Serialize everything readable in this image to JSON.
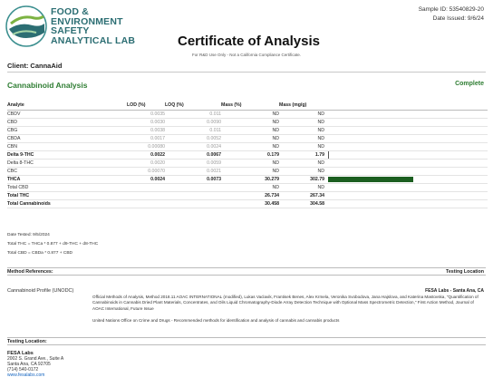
{
  "logo": {
    "lines": [
      "FOOD &",
      "ENVIRONMENT",
      "SAFETY",
      "ANALYTICAL LAB"
    ]
  },
  "header": {
    "sample_id": "Sample ID: 53540829-20",
    "date_issued": "Date Issued: 9/6/24",
    "title": "Certificate of Analysis",
    "rd_note": "For R&D Use Only - Not a California Compliance Certificate."
  },
  "client": "Client: CannaAid",
  "section": {
    "title": "Cannabinoid Analysis",
    "status": "Complete"
  },
  "table": {
    "headers": {
      "analyte": "Analyte",
      "lod": "LOD (%)",
      "loq": "LOQ (%)",
      "mass_pct": "Mass (%)",
      "mass_mg": "Mass (mg/g)"
    },
    "rows": [
      {
        "name": "CBDV",
        "lod": "0.0035",
        "loq": "0.011",
        "mass_pct": "ND",
        "mass_mg": "ND",
        "bold": false
      },
      {
        "name": "CBD",
        "lod": "0.0030",
        "loq": "0.0090",
        "mass_pct": "ND",
        "mass_mg": "ND",
        "bold": false
      },
      {
        "name": "CBG",
        "lod": "0.0038",
        "loq": "0.011",
        "mass_pct": "ND",
        "mass_mg": "ND",
        "bold": false
      },
      {
        "name": "CBDA",
        "lod": "0.0017",
        "loq": "0.0052",
        "mass_pct": "ND",
        "mass_mg": "ND",
        "bold": false
      },
      {
        "name": "CBN",
        "lod": "0.00080",
        "loq": "0.0024",
        "mass_pct": "ND",
        "mass_mg": "ND",
        "bold": false
      },
      {
        "name": "Delta 9-THC",
        "lod": "0.0022",
        "loq": "0.0067",
        "mass_pct": "0.179",
        "mass_mg": "1.79",
        "bold": true
      },
      {
        "name": "Delta 8-THC",
        "lod": "0.0020",
        "loq": "0.0059",
        "mass_pct": "ND",
        "mass_mg": "ND",
        "bold": false
      },
      {
        "name": "CBC",
        "lod": "0.00070",
        "loq": "0.0021",
        "mass_pct": "ND",
        "mass_mg": "ND",
        "bold": false
      },
      {
        "name": "THCA",
        "lod": "0.0024",
        "loq": "0.0073",
        "mass_pct": "30.279",
        "mass_mg": "302.79",
        "bold": true
      },
      {
        "name": "Total CBD",
        "lod": "",
        "loq": "",
        "mass_pct": "ND",
        "mass_mg": "ND",
        "bold": false
      },
      {
        "name": "Total THC",
        "lod": "",
        "loq": "",
        "mass_pct": "26.734",
        "mass_mg": "267.34",
        "bold": true
      },
      {
        "name": "Total Cannabinoids",
        "lod": "",
        "loq": "",
        "mass_pct": "30.458",
        "mass_mg": "304.58",
        "bold": true
      }
    ],
    "bars": {
      "max_mg": 304.58,
      "color": "#1b5e20"
    }
  },
  "notes": {
    "date_tested": "Date Tested: 9/5/2024",
    "total_thc_formula": "Total THC = THCa * 0.877 + d9-THC + d8-THC",
    "total_cbd_formula": "Total CBD = CBDa * 0.877 + CBD"
  },
  "method_band": {
    "left": "Method References:",
    "right": "Testing Location"
  },
  "method": {
    "name": "Cannabinoid Profile (UNODC)",
    "lab": "FESA Labs - Santa Ana, CA",
    "ref1": "Official Methods of Analysis, Method 2018.11 AOAC INTERNATIONAL (modified), Lukas Vaclavik, Frantisek Benes, Alex Krmela, Veronika Svobodova, Jana Hajslova, and Katerina Mastovska, \"Quantification of Cannabinoids in Cannabis Dried Plant Materials, Concentrates, and Oils Liquid Chromatography-Diode Array Detection Technique with Optional Mass Spectrometric Detection,\" First Action Method, Journal of AOAC International, Future Issue",
    "ref2": "United Nations Office on Crime and Drugs - Recommended methods for identification and analysis of cannabis and cannabis products"
  },
  "testing_band": {
    "left": "Testing Location:"
  },
  "testing_location": {
    "name": "FESA Labs",
    "address1": "2002 S. Grand Ave., Suite A",
    "address2": "Santa Ana, CA 92705",
    "phone": "(714) 540-0172",
    "website": "www.fesalabs.com"
  }
}
